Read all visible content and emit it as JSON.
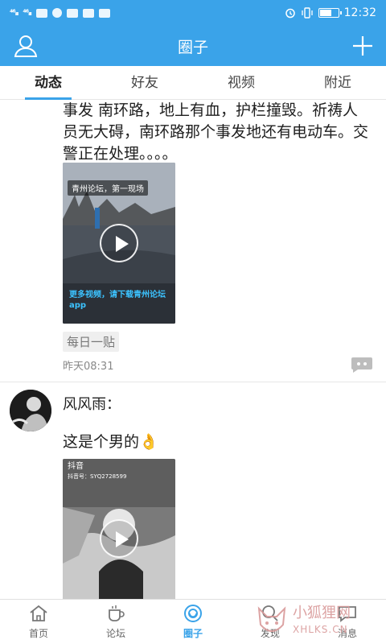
{
  "status_bar": {
    "time": "12:32",
    "signal_1": "⁴⁶ᵢₗₗ",
    "signal_2": "⁴⁶ᵢₗₗ"
  },
  "header": {
    "title": "圈子"
  },
  "tabs": [
    {
      "label": "动态",
      "active": true
    },
    {
      "label": "好友",
      "active": false
    },
    {
      "label": "视频",
      "active": false
    },
    {
      "label": "附近",
      "active": false
    }
  ],
  "posts": [
    {
      "text": "事发 南环路，地上有血，护栏撞毁。祈祷人员无大碍，南环路那个事发地还有电动车。交警正在处理。。。。",
      "video": {
        "caption_top": "青州论坛，第一现场",
        "caption_bottom": "更多视频，请下载青州论坛app"
      },
      "tag": "每日一贴",
      "time": "昨天08:31"
    },
    {
      "author": "风风雨：",
      "text": "这是个男的👌",
      "video": {
        "brand": "抖音",
        "id_text": "抖音号：SYQ2728599"
      }
    }
  ],
  "bottom_nav": [
    {
      "label": "首页",
      "icon": "home-icon",
      "active": false
    },
    {
      "label": "论坛",
      "icon": "cup-icon",
      "active": false
    },
    {
      "label": "圈子",
      "icon": "circle-icon",
      "active": true
    },
    {
      "label": "发现",
      "icon": "search-icon",
      "active": false
    },
    {
      "label": "消息",
      "icon": "message-icon",
      "active": false
    }
  ],
  "watermark": {
    "name": "小狐狸网",
    "url": "XHLKS.CN"
  },
  "colors": {
    "primary": "#3aa3e9",
    "background": "#ffffff",
    "divider": "#e6e6e6"
  }
}
